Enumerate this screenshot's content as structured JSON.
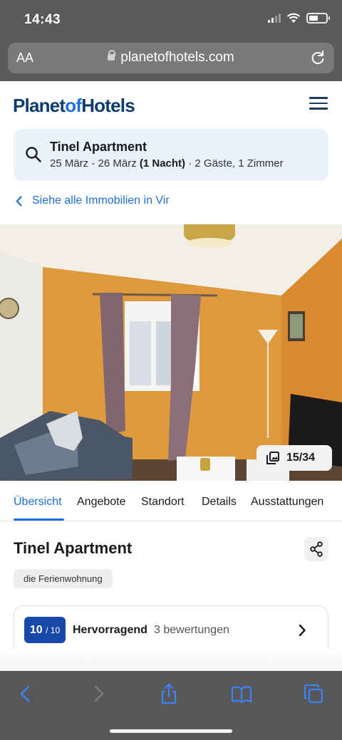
{
  "status_bar": {
    "time": "14:43"
  },
  "browser": {
    "text_size_label": "AA",
    "url": "planetofhotels.com",
    "toolbar": [
      "back",
      "forward",
      "share",
      "bookmarks",
      "tabs"
    ]
  },
  "site": {
    "logo_part1": "Planet",
    "logo_part2": "of",
    "logo_part3": "Hotels"
  },
  "search": {
    "title": "Tinel Apartment",
    "dates": "25 März - 26 März",
    "nights": "(1 Nacht)",
    "guests_rooms": "· 2 Gäste, 1 Zimmer"
  },
  "back_link": "Siehe alle Immobilien in Vir",
  "gallery": {
    "counter": "15/34"
  },
  "tabs": [
    "Übersicht",
    "Angebote",
    "Standort",
    "Details",
    "Ausstattungen"
  ],
  "active_tab": "Übersicht",
  "property": {
    "name": "Tinel Apartment",
    "type": "die Ferienwohnung"
  },
  "rating": {
    "score": "10",
    "scale": "/ 10",
    "label": "Hervorragend",
    "count_text": "3 bewertungen"
  },
  "colors": {
    "brand_dark": "#0f3c6e",
    "brand_blue": "#1e6fd9",
    "score_badge": "#1848a8",
    "search_card_bg": "#e9f1fb"
  }
}
